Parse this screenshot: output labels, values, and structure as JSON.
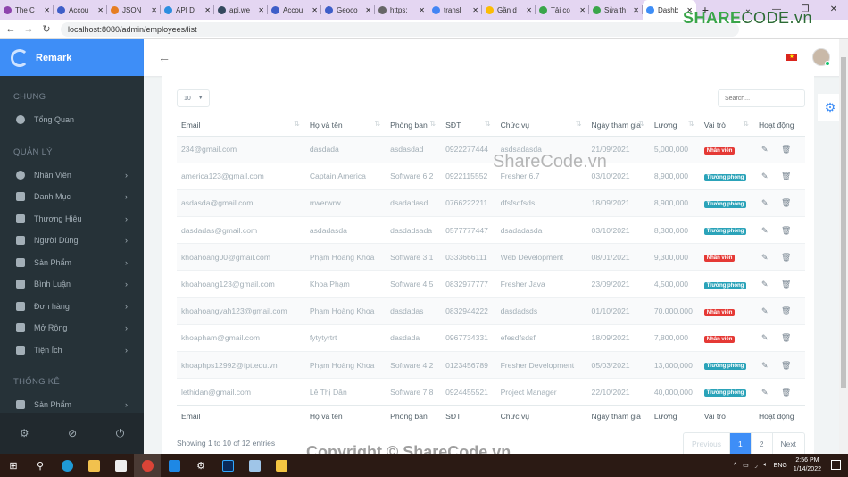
{
  "browser": {
    "tabs": [
      {
        "label": "The C",
        "color": "#8e44ad"
      },
      {
        "label": "Accou",
        "color": "#3e5ec8"
      },
      {
        "label": "JSON",
        "color": "#e67e22"
      },
      {
        "label": "API D",
        "color": "#2c8ee0"
      },
      {
        "label": "api.we",
        "color": "#34495e"
      },
      {
        "label": "Accou",
        "color": "#3e5ec8"
      },
      {
        "label": "Geoco",
        "color": "#3e5ec8"
      },
      {
        "label": "https:",
        "color": "#666666"
      },
      {
        "label": "transl",
        "color": "#4285f4"
      },
      {
        "label": "Gần d",
        "color": "#fbbc05"
      },
      {
        "label": "Tải co",
        "color": "#3aa64a"
      },
      {
        "label": "Sửa th",
        "color": "#3aa64a"
      },
      {
        "label": "Dashb",
        "color": "#3e8ef7",
        "active": true
      }
    ],
    "close_glyph": "✕",
    "new_tab": "+",
    "url": "localhost:8080/admin/employees/list",
    "watermark_brand": "SHARE",
    "watermark_brand2": "CODE.vn"
  },
  "sidebar": {
    "app_name": "Remark",
    "sections": [
      {
        "title": "CHUNG",
        "items": [
          {
            "label": "Tổng Quan",
            "icon": "dashboard-icon",
            "chevron": false
          }
        ]
      },
      {
        "title": "QUẢN LÝ",
        "items": [
          {
            "label": "Nhân Viên",
            "icon": "user-circle-icon",
            "chevron": true
          },
          {
            "label": "Danh Mục",
            "icon": "list-icon",
            "chevron": true
          },
          {
            "label": "Thương Hiệu",
            "icon": "chip-icon",
            "chevron": true
          },
          {
            "label": "Người Dùng",
            "icon": "users-icon",
            "chevron": true
          },
          {
            "label": "Sản Phẩm",
            "icon": "phone-icon",
            "chevron": true
          },
          {
            "label": "Bình Luận",
            "icon": "comment-icon",
            "chevron": true
          },
          {
            "label": "Đơn hàng",
            "icon": "cart-icon",
            "chevron": true
          },
          {
            "label": "Mở Rộng",
            "icon": "puzzle-icon",
            "chevron": true
          },
          {
            "label": "Tiện Ích",
            "icon": "users-icon",
            "chevron": true
          }
        ]
      },
      {
        "title": "THỐNG KÊ",
        "items": [
          {
            "label": "Sản Phẩm",
            "icon": "phone-icon",
            "chevron": true
          }
        ]
      }
    ]
  },
  "table": {
    "page_length": "10",
    "search_placeholder": "Search...",
    "columns": [
      "Email",
      "Họ và tên",
      "Phòng ban",
      "SĐT",
      "Chức vụ",
      "Ngày tham gia",
      "Lương",
      "Vai trò",
      "Hoạt động"
    ],
    "rows": [
      {
        "email": "234@gmail.com",
        "name": "dasdada",
        "dept": "asdasdad",
        "phone": "0922277444",
        "position": "asdsadasda",
        "joined": "21/09/2021",
        "salary": "5,000,000",
        "role": "Nhân viên",
        "role_color": "#e53935"
      },
      {
        "email": "america123@gmail.com",
        "name": "Captain America",
        "dept": "Software 6.2",
        "phone": "0922115552",
        "position": "Fresher 6.7",
        "joined": "03/10/2021",
        "salary": "8,900,000",
        "role": "Trưởng phòng",
        "role_color": "#2ba3b9"
      },
      {
        "email": "asdasda@gmail.com",
        "name": "rrwerwrw",
        "dept": "dsadadasd",
        "phone": "0766222211",
        "position": "dfsfsdfsds",
        "joined": "18/09/2021",
        "salary": "8,900,000",
        "role": "Trưởng phòng",
        "role_color": "#2ba3b9"
      },
      {
        "email": "dasdadas@gmail.com",
        "name": "asdadasda",
        "dept": "dasdadsada",
        "phone": "0577777447",
        "position": "dsadadasda",
        "joined": "03/10/2021",
        "salary": "8,300,000",
        "role": "Trưởng phòng",
        "role_color": "#2ba3b9"
      },
      {
        "email": "khoahoang00@gmail.com",
        "name": "Phạm Hoàng Khoa",
        "dept": "Software 3.1",
        "phone": "0333666111",
        "position": "Web Development",
        "joined": "08/01/2021",
        "salary": "9,300,000",
        "role": "Nhân viên",
        "role_color": "#e53935"
      },
      {
        "email": "khoahoang123@gmail.com",
        "name": "Khoa Phạm",
        "dept": "Software 4.5",
        "phone": "0832977777",
        "position": "Fresher Java",
        "joined": "23/09/2021",
        "salary": "4,500,000",
        "role": "Trưởng phòng",
        "role_color": "#2ba3b9"
      },
      {
        "email": "khoahoangyah123@gmail.com",
        "name": "Phạm Hoàng Khoa",
        "dept": "dasdadas",
        "phone": "0832944222",
        "position": "dasdadsds",
        "joined": "01/10/2021",
        "salary": "70,000,000",
        "role": "Nhân viên",
        "role_color": "#e53935"
      },
      {
        "email": "khoapham@gmail.com",
        "name": "fytytyrtrt",
        "dept": "dasdada",
        "phone": "0967734331",
        "position": "efesdfsdsf",
        "joined": "18/09/2021",
        "salary": "7,800,000",
        "role": "Nhân viên",
        "role_color": "#e53935"
      },
      {
        "email": "khoaphps12992@fpt.edu.vn",
        "name": "Phạm Hoàng Khoa",
        "dept": "Software 4.2",
        "phone": "0123456789",
        "position": "Fresher Development",
        "joined": "05/03/2021",
        "salary": "13,000,000",
        "role": "Trưởng phòng",
        "role_color": "#2ba3b9"
      },
      {
        "email": "lethidan@gmail.com",
        "name": "Lê Thị Dân",
        "dept": "Software 7.8",
        "phone": "0924455521",
        "position": "Project Manager",
        "joined": "22/10/2021",
        "salary": "40,000,000",
        "role": "Trưởng phòng",
        "role_color": "#2ba3b9"
      }
    ],
    "info": "Showing 1 to 10 of 12 entries",
    "pagination": {
      "previous": "Previous",
      "pages": [
        "1",
        "2"
      ],
      "current": "1",
      "next": "Next"
    }
  },
  "watermarks": {
    "center": "ShareCode.vn",
    "bottom": "Copyright © ShareCode.vn"
  },
  "taskbar": {
    "tray_lang": "ENG",
    "time": "2:56 PM",
    "date": "1/14/2022"
  },
  "colors": {
    "accent": "#3e8ef7",
    "sidebar_bg": "#263238",
    "danger": "#e53935",
    "info": "#2ba3b9"
  }
}
